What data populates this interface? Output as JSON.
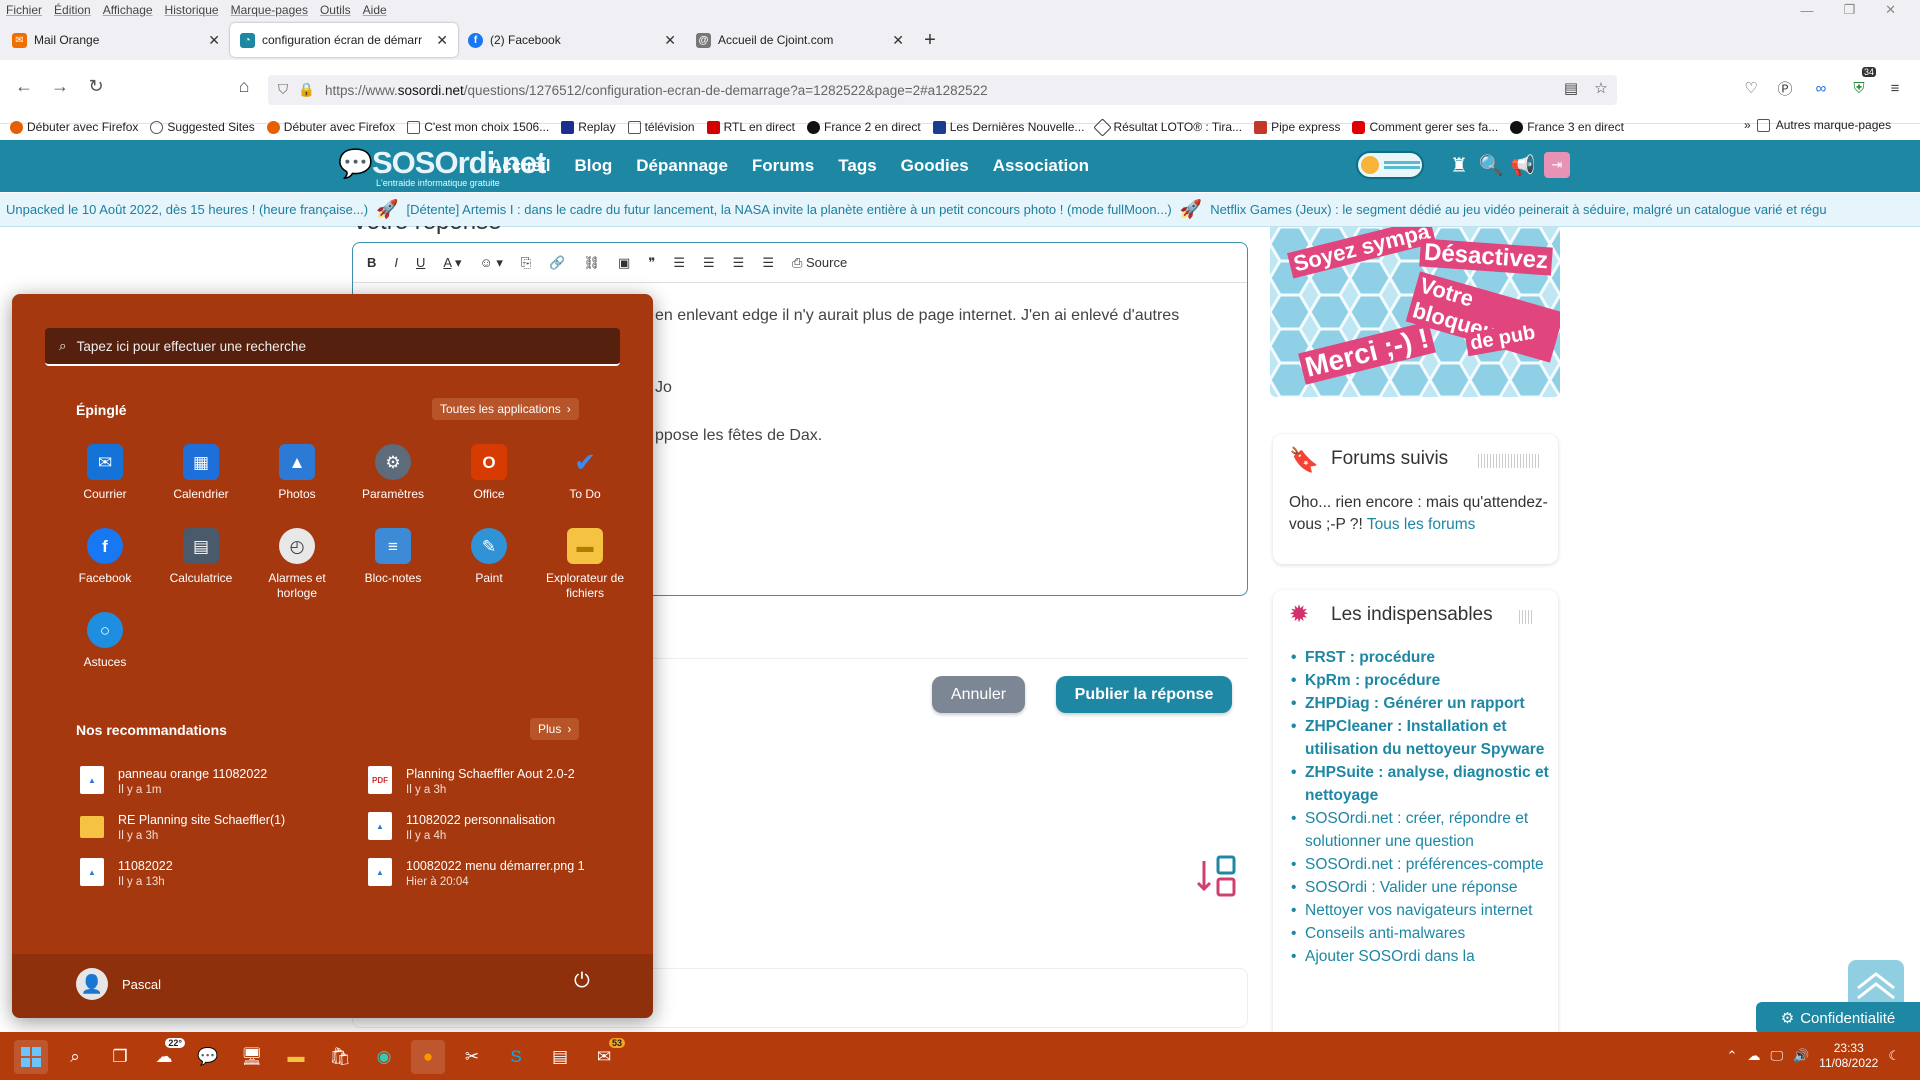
{
  "menubar": [
    "Fichier",
    "Édition",
    "Affichage",
    "Historique",
    "Marque-pages",
    "Outils",
    "Aide"
  ],
  "tabs": [
    {
      "title": "Mail Orange",
      "icon": "mail-orange-icon",
      "color": "#f16e00",
      "active": false
    },
    {
      "title": "configuration écran de démarr",
      "icon": "sosordi-icon",
      "color": "#1d87a4",
      "active": true
    },
    {
      "title": "(2) Facebook",
      "icon": "facebook-icon",
      "color": "#1877f2",
      "active": false
    },
    {
      "title": "Accueil de Cjoint.com",
      "icon": "cjoint-icon",
      "color": "#666666",
      "active": false
    }
  ],
  "url": {
    "prefix": "https://www.",
    "host": "sosordi.net",
    "path": "/questions/1276512/configuration-ecran-de-demarrage?a=1282522&page=2#a1282522"
  },
  "extension_badge": "34",
  "bookmarks": [
    {
      "label": "Débuter avec Firefox",
      "color": "#e66000"
    },
    {
      "label": "Suggested Sites",
      "color": "#555555"
    },
    {
      "label": "Débuter avec Firefox",
      "color": "#e66000"
    },
    {
      "label": "C'est mon choix  1506...",
      "color": "#444444"
    },
    {
      "label": "Replay",
      "color": "#1b2f8f"
    },
    {
      "label": "télévision",
      "color": "#444444"
    },
    {
      "label": "RTL en direct",
      "color": "#d40000"
    },
    {
      "label": "France 2 en direct",
      "color": "#111111"
    },
    {
      "label": "Les Dernières Nouvelle...",
      "color": "#1a3d8f"
    },
    {
      "label": "Résultat LOTO® : Tira...",
      "color": "#333333"
    },
    {
      "label": "Pipe express",
      "color": "#c0392b"
    },
    {
      "label": "Comment gerer ses fa...",
      "color": "#e00000"
    },
    {
      "label": "France 3 en direct",
      "color": "#111111"
    }
  ],
  "bookmarks_more": "Autres marque-pages",
  "site": {
    "logo": "SOSOrdi.net",
    "tagline": "L'entraide informatique gratuite",
    "menu": [
      "Accueil",
      "Blog",
      "Dépannage",
      "Forums",
      "Tags",
      "Goodies",
      "Association"
    ]
  },
  "ticker": [
    "Unpacked le 10 Août 2022, dès 15 heures ! (heure française...)",
    "[Détente] Artemis I : dans le cadre du futur lancement, la NASA invite la planète entière à un petit concours photo ! (mode fullMoon...)",
    "Netflix Games (Jeux) : le segment dédié au jeu vidéo peinerait à séduire, malgré un catalogue varié et régu"
  ],
  "editor": {
    "heading": "Votre réponse",
    "source_label": "Source",
    "lines": [
      "en enlevant edge il n'y aurait plus de page internet. J'en ai enlevé d'autres",
      "Jo",
      "ppose les fêtes de Dax."
    ],
    "cancel": "Annuler",
    "publish": "Publier la réponse"
  },
  "ad": {
    "line1": "Soyez sympa",
    "line2": "Désactivez",
    "line3": "Votre bloqueur",
    "line4": "de pub",
    "line5": "Merci ;-) !"
  },
  "followed": {
    "title": "Forums suivis",
    "text": "Oho... rien encore : mais qu'attendez-vous ;-P ?!",
    "link": "Tous les forums"
  },
  "indispensables": {
    "title": "Les indispensables",
    "items": [
      {
        "label": "FRST : procédure",
        "bold": true
      },
      {
        "label": "KpRm : procédure",
        "bold": true
      },
      {
        "label": "ZHPDiag : Générer un rapport",
        "bold": true
      },
      {
        "label": "ZHPCleaner : Installation et utilisation du nettoyeur Spyware",
        "bold": true
      },
      {
        "label": "ZHPSuite : analyse, diagnostic et nettoyage",
        "bold": true
      },
      {
        "label": "SOSOrdi.net : créer, répondre et solutionner une question",
        "bold": false
      },
      {
        "label": "SOSOrdi.net : préférences-compte",
        "bold": false
      },
      {
        "label": "SOSOrdi : Valider une réponse",
        "bold": false
      },
      {
        "label": "Nettoyer vos navigateurs internet",
        "bold": false
      },
      {
        "label": "Conseils anti-malwares",
        "bold": false
      },
      {
        "label": "Ajouter SOSOrdi dans la",
        "bold": false
      }
    ]
  },
  "privacy": "Confidentialité",
  "start": {
    "search_placeholder": "Tapez ici pour effectuer une recherche",
    "pinned_title": "Épinglé",
    "all_apps": "Toutes les applications",
    "apps": [
      {
        "label": "Courrier",
        "icon": "mail-icon",
        "color": "#1572d6",
        "glyph": "✉"
      },
      {
        "label": "Calendrier",
        "icon": "calendar-icon",
        "color": "#1e6fd9",
        "glyph": "▦"
      },
      {
        "label": "Photos",
        "icon": "photos-icon",
        "color": "#2c7ad6",
        "glyph": "▲"
      },
      {
        "label": "Paramètres",
        "icon": "settings-gear-icon",
        "color": "#5d6b7a",
        "glyph": "⚙"
      },
      {
        "label": "Office",
        "icon": "office-icon",
        "color": "#d83b01",
        "glyph": "O"
      },
      {
        "label": "To Do",
        "icon": "todo-check-icon",
        "color": "#2564cf",
        "glyph": "✔"
      },
      {
        "label": "Facebook",
        "icon": "facebook-icon",
        "color": "#1877f2",
        "glyph": "f"
      },
      {
        "label": "Calculatrice",
        "icon": "calculator-icon",
        "color": "#4a5a6a",
        "glyph": "▤"
      },
      {
        "label": "Alarmes et horloge",
        "icon": "clock-icon",
        "color": "#e8e8e8",
        "glyph": "◴"
      },
      {
        "label": "Bloc-notes",
        "icon": "notepad-icon",
        "color": "#3d8bd6",
        "glyph": "≡"
      },
      {
        "label": "Paint",
        "icon": "paint-palette-icon",
        "color": "#2f93d6",
        "glyph": "✎"
      },
      {
        "label": "Explorateur de fichiers",
        "icon": "folder-icon",
        "color": "#f5c341",
        "glyph": "▬"
      },
      {
        "label": "Astuces",
        "icon": "lightbulb-icon",
        "color": "#1e8fe0",
        "glyph": "💡"
      }
    ],
    "rec_title": "Nos recommandations",
    "more": "Plus",
    "recs": [
      {
        "name": "panneau orange 11082022",
        "time": "Il y a 1m",
        "icon": "image-file-icon",
        "kind": "img"
      },
      {
        "name": "Planning Schaeffler Aout 2.0-2",
        "time": "Il y a 3h",
        "icon": "pdf-file-icon",
        "kind": "pdf"
      },
      {
        "name": "RE Planning site Schaeffler(1)",
        "time": "Il y a 3h",
        "icon": "folder-icon",
        "kind": "folder"
      },
      {
        "name": "11082022 personnalisation",
        "time": "Il y a 4h",
        "icon": "image-file-icon",
        "kind": "img"
      },
      {
        "name": "11082022",
        "time": "Il y a 13h",
        "icon": "image-file-icon",
        "kind": "img"
      },
      {
        "name": "10082022 menu démarrer.png 1",
        "time": "Hier à 20:04",
        "icon": "image-file-icon",
        "kind": "img"
      }
    ],
    "user": "Pascal"
  },
  "taskbar": {
    "weather": "22°",
    "mail_badge": "53",
    "time": "23:33",
    "date": "11/08/2022"
  },
  "colors": {
    "accent_site": "#1d87a4",
    "start_bg": "#a5380f",
    "taskbar_bg": "#b43c0c"
  }
}
